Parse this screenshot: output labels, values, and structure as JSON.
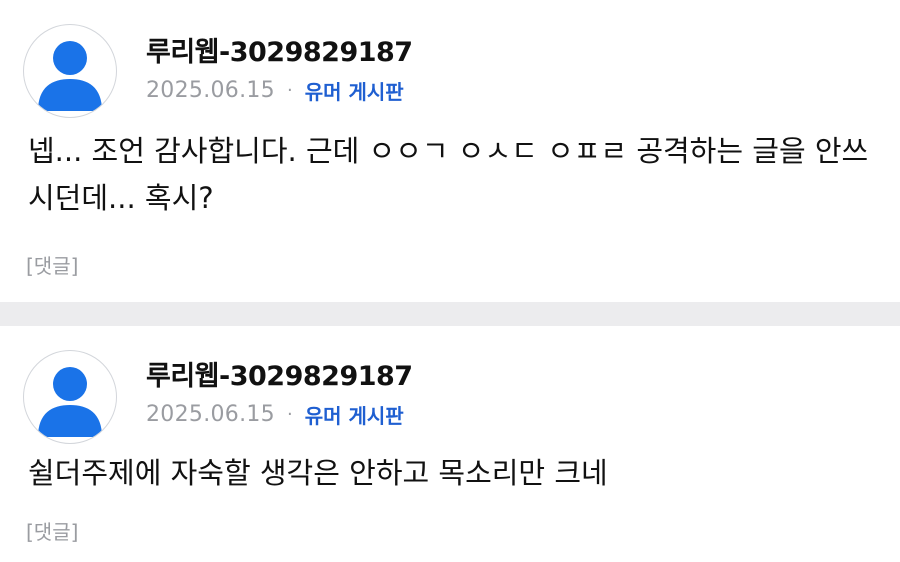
{
  "comments": [
    {
      "author": "루리웹-3029829187",
      "date": "2025.06.15",
      "separator": "·",
      "board": "유머 게시판",
      "body": "넵... 조언 감사합니다. 근데 ㅇㅇㄱ ㅇㅅㄷ ㅇㅍㄹ 공격하는 글을 안쓰시던데... 혹시?",
      "reply_label": "[댓글]",
      "avatar_icon": "user-silhouette-icon"
    },
    {
      "author": "루리웹-3029829187",
      "date": "2025.06.15",
      "separator": "·",
      "board": "유머 게시판",
      "body": "쉴더주제에 자숙할 생각은 안하고 목소리만 크네",
      "reply_label": "[댓글]",
      "avatar_icon": "user-silhouette-icon"
    }
  ],
  "colors": {
    "accent": "#1f5fd1",
    "avatar_blue": "#1a73e8",
    "muted": "#9a9ca1",
    "divider": "#ececee"
  }
}
